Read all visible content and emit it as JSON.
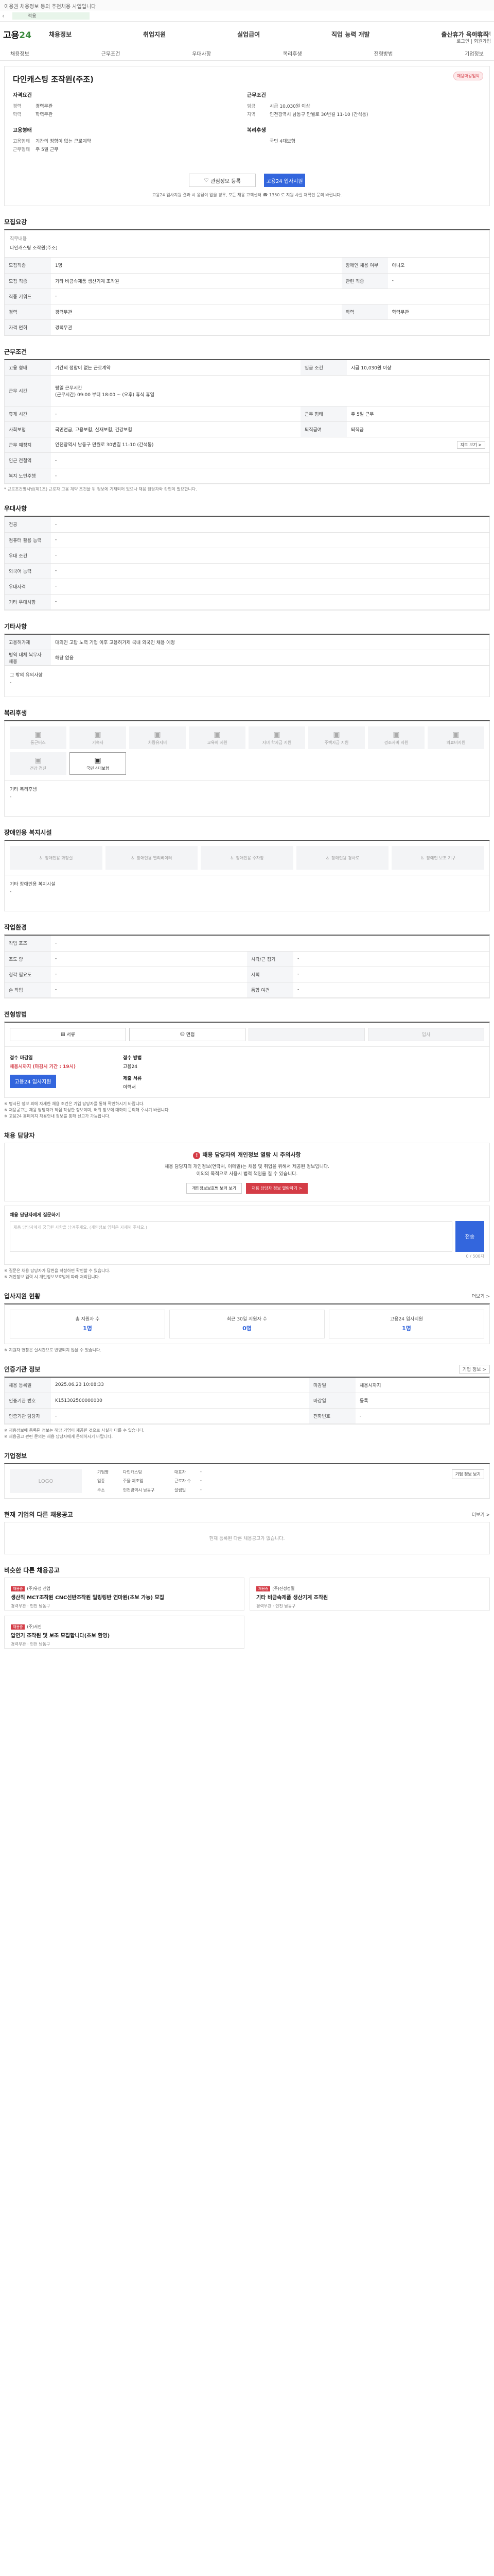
{
  "top_notice": "이용권 채용정보 등의 추천채용 사업입니다",
  "mainbar": {
    "label": "적용"
  },
  "logo": {
    "pre": "고용",
    "num": "24"
  },
  "gnb": [
    "채용정보",
    "취업지원",
    "실업급여",
    "직업 능력 개발",
    "출산휴가 육아휴직"
  ],
  "util": {
    "line1": "채용 검색",
    "line2": "로그인 | 회원가입"
  },
  "subnav": [
    "채용정보",
    "근무조건",
    "우대사항",
    "복리후생",
    "전형방법",
    "기업정보"
  ],
  "hero": {
    "badge": "채용마감임박",
    "company": "다인캐스팅 조작원(주조)",
    "recruit_head": "자격요건",
    "work_head": "근무조건",
    "recruit": [
      {
        "k": "경력",
        "v": "경력무관"
      },
      {
        "k": "학력",
        "v": "학력무관"
      }
    ],
    "work": [
      {
        "k": "임금",
        "v": "시급 10,030원 이상"
      },
      {
        "k": "지역",
        "v": "인천광역시 남동구 만월로 30번길 11-10 (간석동)"
      }
    ],
    "employ_head": "고용형태",
    "employ": [
      {
        "k": "고용형태",
        "v": "기간의 정함이 없는 근로계약"
      },
      {
        "k": "근무형태",
        "v": "주 5일 근무"
      }
    ],
    "etc_head": "복리후생",
    "etc": [
      {
        "k": "",
        "v": "국민 4대보험"
      }
    ],
    "btn_save": "관심정보 등록",
    "btn_apply": "고용24 입사지원",
    "note": "고용24 입사지원 결과 시 응답이 없을 경우, 모든 채용 고객센터 ☎ 1350 로 지원 사실 재확인 문의 바랍니다."
  },
  "s1": {
    "title": "모집요강",
    "desc_label": "직무내용",
    "desc": "다인캐스팅 조작원(주조)",
    "rows": [
      [
        "모집직종",
        "1명",
        "장애인 채용 여부",
        "아니오"
      ],
      [
        "모집 직종",
        "기타 비금속제품 생산기계 조작원",
        "관련 직종",
        "-"
      ],
      [
        "직종 키워드",
        "-",
        "",
        ""
      ],
      [
        "경력",
        "경력무관",
        "학력",
        "학력무관"
      ],
      [
        "자격 면허",
        "경력무관",
        "",
        ""
      ]
    ]
  },
  "s2": {
    "title": "근무조건",
    "rows": [
      [
        "고용 형태",
        "기간의 정함이 없는 근로계약",
        "임금 조건",
        "시급 10,030원 이상"
      ],
      [
        "근무 시간",
        "평일 근무시간\n(근무시간) 09:00 부터 18:00 ~ (오후) 휴식 휴일",
        "",
        ""
      ],
      [
        "휴게 시간",
        "-",
        "근무 형태",
        "주 5일 근무"
      ],
      [
        "사회보험",
        "국민연금, 고용보험, 산재보험, 건강보험",
        "퇴직급여",
        "퇴직금"
      ],
      [
        "근무 예정지",
        "인천광역시 남동구 만월로 30번길 11-10 (간석동)",
        "",
        ""
      ],
      [
        "인근 전철역",
        "-",
        "",
        ""
      ],
      [
        "복지 노인주행",
        "-",
        "",
        ""
      ]
    ],
    "map_btn": "지도 보기 >",
    "note": "* 근로조건명시법(제1조) 근로자 고용 계약 조건을 위 정보에 기재되어 있으나 채용 담당자와 확인이 필요합니다."
  },
  "s3": {
    "title": "우대사항",
    "rows": [
      [
        "전공",
        "-"
      ],
      [
        "컴퓨터 활용 능력",
        "-"
      ],
      [
        "우대 조건",
        "-"
      ],
      [
        "외국어 능력",
        "-"
      ],
      [
        "우대자격",
        "-"
      ],
      [
        "기타 우대사항",
        "-"
      ]
    ]
  },
  "s4": {
    "title": "기타사항",
    "rows": [
      [
        "고용허가제",
        "대외인 고탑 노력 기업 이후 고용허가제 국내 외국인 채용 예정"
      ],
      [
        "병역 대체 복무자 채용",
        "해당 없음"
      ]
    ],
    "dash_label": "그 밖의 유의사항",
    "dash": "-"
  },
  "s5": {
    "title": "복리후생",
    "items": [
      "통근버스",
      "기숙사",
      "차량유지비",
      "교육비 지원",
      "자녀 학자금 지원",
      "주택자금 지원",
      "경조사비 지원",
      "의료비지원",
      "건강 검진",
      "국민 4대보험"
    ],
    "active_index": 9,
    "dash_label": "기타 복리후생",
    "dash": "-"
  },
  "s6": {
    "title": "장애인용 복지시설",
    "items": [
      "장애인용 화장실",
      "장애인용 엘리베이터",
      "장애인용 주차장",
      "장애인용 경사로",
      "장애인 보조 기구"
    ],
    "dash_label": "기타 장애인용 복지시설",
    "dash": "-"
  },
  "s7": {
    "title": "작업환경",
    "rows": [
      [
        "작업 포즈",
        "-",
        "",
        ""
      ],
      [
        "조도 량",
        "-",
        "시각/근 접기",
        "-"
      ],
      [
        "청각 필요도",
        "-",
        "시력",
        "-"
      ],
      [
        "손 작업",
        "-",
        "통합 여건",
        "-"
      ]
    ]
  },
  "s8": {
    "title": "전형방법",
    "steps": [
      "서류",
      "면접",
      "",
      "입사"
    ],
    "col1_head": "접수 마감일",
    "col1_val": "채용시까지 (마감시 기간 : 19시)",
    "col1_btn": "고용24 입사지원",
    "col2_head": "접수 방법",
    "col2_val": "고용24",
    "col3_head": "제출 서류",
    "col3_val": "이력서",
    "notes": [
      "※ 명시된 정보 외에 자세한 채용 조건은 기업 담당자를 통해 확인하시기 바랍니다.",
      "※ 채용공고는 채용 담당자가 직접 작성한 정보이며, 허위 정보에 대하여 문의해 주시기 바랍니다.",
      "※ 고용24 홈페이지 채용안내 정보를 통해 신고가 가능합니다."
    ]
  },
  "s9": {
    "title": "채용 담당자",
    "warn_title": "채용 담당자의 개인정보 열람 시 주의사항",
    "warn_text": "채용 담당자의 개인정보(연락처, 이메일)는 채용 및 취업을 위해서 제공된 정보입니다.\n이외의 목적으로 사용시 법적 책임을 질 수 있습니다.",
    "btn1": "개인정보보호법 보러 보기",
    "btn2": "채용 담당자 정보 열람하기 >",
    "inq_label": "채용 담당자에게 질문하기",
    "inq_placeholder": "채용 담당자에게 궁금한 사항을 남겨주세요. (개인정보 입력은 자제해 주세요.)",
    "inq_btn": "전송",
    "inq_count": "0 / 500자",
    "notes": [
      "※ 질문은 채용 담당자가 답변을 작성하면 확인할 수 있습니다.",
      "※ 개인정보 입력 시 개인정보보호법에 따라 처리됩니다."
    ]
  },
  "s10": {
    "title": "입사지원 현황",
    "more": "더보기 >",
    "stats": [
      {
        "label": "총 지원자 수",
        "num": "1명"
      },
      {
        "label": "최근 30일 지원자 수",
        "num": "0명"
      },
      {
        "label": "고용24 입사지원",
        "num": "1명"
      }
    ],
    "note": "※ 지원자 현황은 실시간으로 반영되지 않을 수 있습니다."
  },
  "s11": {
    "title": "인증기관 정보",
    "btn": "기업 정보 >",
    "rows": [
      [
        "채용 등록일",
        "2025.06.23 10:08:33",
        "마감일",
        "채용시까지"
      ],
      [
        "인증기관 번호",
        "K151302500000000",
        "마감일",
        "등록"
      ],
      [
        "인증기관 담당자",
        "-",
        "전화번호",
        "-"
      ]
    ],
    "notes": [
      "※ 채용정보에 등록된 정보는 해당 기업이 제공한 것으로 사실과 다를 수 있습니다.",
      "※ 채용공고 관련 문의는 채용 담당자에게 문의하시기 바랍니다."
    ]
  },
  "s12": {
    "title": "기업정보",
    "logo": "LOGO",
    "btn": "기업 정보 보기",
    "info": [
      [
        "기업명",
        "다인캐스팅"
      ],
      [
        "대표자",
        "-"
      ],
      [
        "업종",
        "주물 제조업"
      ],
      [
        "근로자 수",
        "-"
      ],
      [
        "주소",
        "인천광역시 남동구"
      ],
      [
        "설립일",
        "-"
      ]
    ]
  },
  "s13": {
    "title": "현재 기업의 다른 채용공고",
    "more": "더보기 >",
    "empty": "현재 등록된 다른 채용공고가 없습니다."
  },
  "s14": {
    "title": "비슷한 다른 채용공고",
    "cards": [
      {
        "tag": "채용중",
        "company": "(주)유성 산업",
        "title": "생산직 MCT조작원 CNC선반조작원 밀링링반 연마원(초보 가능) 모집",
        "meta": "경력무관 · 인천 남동구"
      },
      {
        "tag": "채용중",
        "company": "(주)진성정밀",
        "title": "기타 비금속제품 생산기계 조작원",
        "meta": "경력무관 · 인천 남동구"
      },
      {
        "tag": "채용중",
        "company": "(주)서진",
        "title": "압연기 조작원 및 보조 모집합니다(초보 환영)",
        "meta": "경력무관 · 인천 남동구"
      }
    ]
  }
}
